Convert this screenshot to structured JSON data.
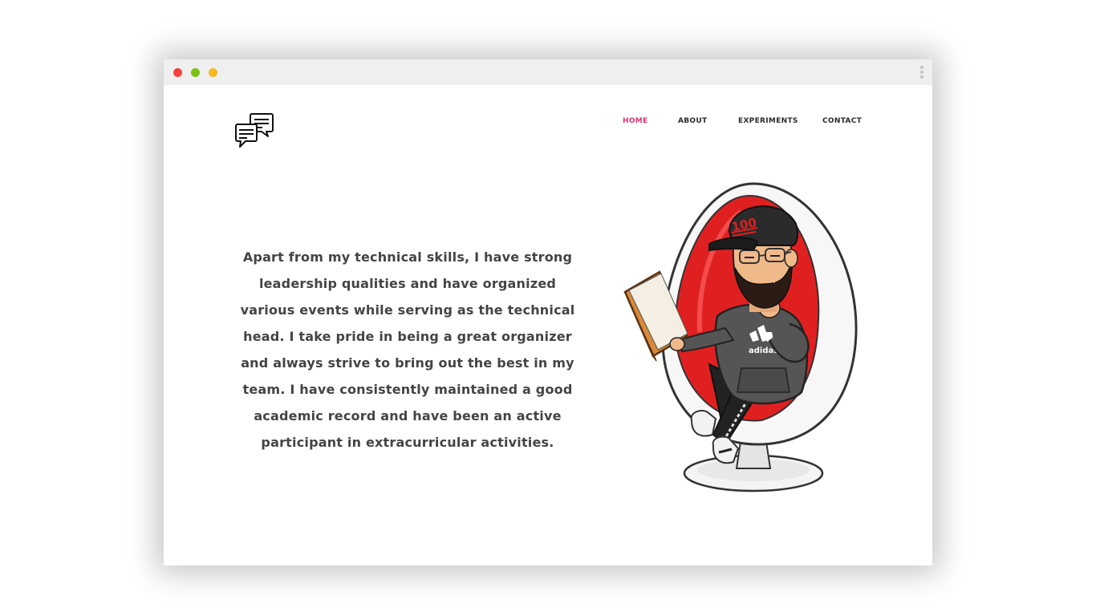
{
  "window": {
    "controls": [
      "close",
      "minimize",
      "maximize"
    ],
    "menu_icon": "kebab-menu-icon"
  },
  "header": {
    "logo_icon": "chat-bubbles-icon",
    "nav": [
      {
        "label": "HOME",
        "active": true
      },
      {
        "label": "ABOUT",
        "active": false
      },
      {
        "label": "EXPERIMENTS",
        "active": false
      },
      {
        "label": "CONTACT",
        "active": false
      }
    ]
  },
  "main": {
    "bio": "Apart from my technical skills, I have strong leadership qualities and have organized various events while serving as the technical head. I take pride in being a great organizer and always strive to bring out the best in my team. I have consistently maintained a good academic record and have been an active participant in extracurricular activities.",
    "avatar": {
      "icon": "avatar-reading-illustration",
      "cap_text": "100",
      "hoodie_text": "adidas"
    }
  },
  "colors": {
    "accent": "#e4316f",
    "text": "#444444",
    "nav_text": "#2b2b2b",
    "titlebar": "#efefef",
    "chair_red": "#e02020"
  }
}
